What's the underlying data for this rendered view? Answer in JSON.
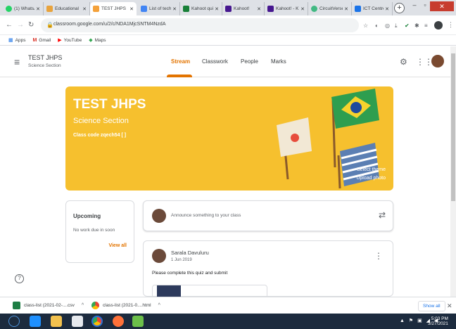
{
  "browser": {
    "tabs": [
      {
        "label": "(1) WhatsApp",
        "icon": "whatsapp-icon",
        "color": "#25d366"
      },
      {
        "label": "Educational",
        "icon": "education-icon",
        "color": "#e8a33c"
      },
      {
        "label": "TEST JHPS",
        "icon": "classroom-icon",
        "color": "#f4a13a",
        "active": true
      },
      {
        "label": "List of tech",
        "icon": "docs-icon",
        "color": "#4285f4"
      },
      {
        "label": "Kahoot quiz",
        "icon": "sheets-icon",
        "color": "#188038"
      },
      {
        "label": "Kahoot!",
        "icon": "kahoot-icon",
        "color": "#46178f"
      },
      {
        "label": "Kahoot! - K",
        "icon": "kahoot-icon",
        "color": "#46178f"
      },
      {
        "label": "CircuitVerse",
        "icon": "circuitverse-icon",
        "color": "#42b983"
      },
      {
        "label": "ICT Centre",
        "icon": "ict-icon",
        "color": "#1a73e8"
      }
    ],
    "new_tab": "+",
    "close": "✕",
    "url": "classroom.google.com/u/2/c/NDA1MjcSNTM4NzdA",
    "bookmarks": [
      {
        "label": "Apps",
        "icon": "apps-grid-icon"
      },
      {
        "label": "Gmail",
        "icon": "gmail-icon"
      },
      {
        "label": "YouTube",
        "icon": "youtube-icon"
      },
      {
        "label": "Maps",
        "icon": "maps-icon"
      }
    ]
  },
  "classroom": {
    "class_name": "TEST JHPS",
    "class_section": "Science Section",
    "nav_tabs": [
      "Stream",
      "Classwork",
      "People",
      "Marks"
    ],
    "active_tab": "Stream",
    "accent": "#e37400",
    "banner": {
      "title": "TEST JHPS",
      "subtitle": "Science Section",
      "class_code": "Class code  zqech54 [ ]",
      "select_theme": "Select theme",
      "upload_photo": "Upload photo",
      "color": "#f6c02e"
    },
    "upcoming": {
      "title": "Upcoming",
      "empty": "No work due in soon",
      "view_all": "View all"
    },
    "announce_placeholder": "Announce something to your class",
    "post": {
      "author": "Sarala Davuluru",
      "date": "1 Jun 2019",
      "body": "Please complete this quiz and submit"
    }
  },
  "downloads": {
    "items": [
      {
        "label": "class-list (2021-02-....csv"
      },
      {
        "label": "class-list (2021-0....html"
      }
    ],
    "show_all": "Show all"
  },
  "taskbar": {
    "time": "5:03 PM",
    "date": "3/27/2021"
  }
}
